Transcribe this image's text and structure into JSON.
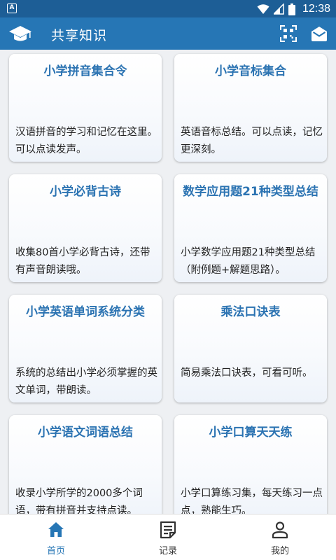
{
  "status_bar": {
    "time": "12:38",
    "icons": [
      "notification-a-icon",
      "wifi-icon",
      "signal-icon",
      "battery-icon"
    ],
    "notification_glyph": "A"
  },
  "app_bar": {
    "title": "共享知识",
    "icons": [
      "graduation-cap-icon",
      "qr-scan-icon",
      "mail-icon"
    ]
  },
  "colors": {
    "status_bar": "#1d5e96",
    "app_bar": "#2676b5",
    "card_title": "#2b73b2",
    "nav_active": "#2676b5",
    "nav_inactive": "#333333"
  },
  "cards": [
    {
      "title": "小学拼音集合令",
      "description": "汉语拼音的学习和记忆在这里。可以点读发声。"
    },
    {
      "title": "小学音标集合",
      "description": "英语音标总结。可以点读，记忆更深刻。"
    },
    {
      "title": "小学必背古诗",
      "description": "收集80首小学必背古诗，还带有声音朗读哦。"
    },
    {
      "title": "数学应用题21种类型总结",
      "description": "小学数学应用题21种类型总结（附例题+解题思路）。"
    },
    {
      "title": "小学英语单词系统分类",
      "description": "系统的总结出小学必须掌握的英文单词，带朗读。"
    },
    {
      "title": "乘法口诀表",
      "description": "简易乘法口诀表，可看可听。"
    },
    {
      "title": "小学语文词语总结",
      "description": "收录小学所学的2000多个词语，带有拼音并支持点读。"
    },
    {
      "title": "小学口算天天练",
      "description": "小学口算练习集，每天练习一点点，熟能生巧。"
    }
  ],
  "bottom_nav": [
    {
      "label": "首页",
      "icon": "home-icon",
      "active": true
    },
    {
      "label": "记录",
      "icon": "notes-icon",
      "active": false
    },
    {
      "label": "我的",
      "icon": "person-icon",
      "active": false
    }
  ]
}
